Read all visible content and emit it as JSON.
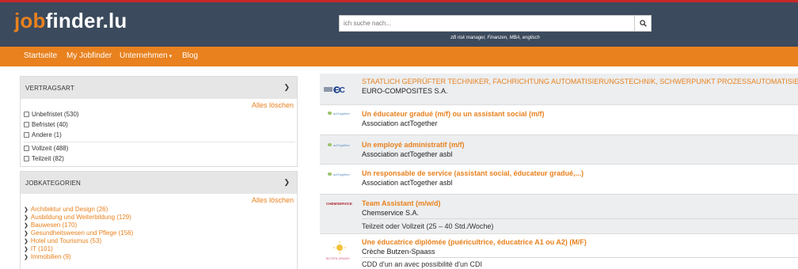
{
  "header": {
    "logo_part1": "job",
    "logo_part2": "finder.lu",
    "search_placeholder": "ich suche nach...",
    "search_hint": "zB risk manager, Finanzen, MBA, englisch"
  },
  "nav": {
    "items": [
      "Startseite",
      "My Jobfinder",
      "Unternehmen",
      "Blog"
    ]
  },
  "filters": {
    "vertragsart": {
      "title": "VERTRAGSART",
      "clear_label": "Alles löschen",
      "options": [
        "Unbefristet (530)",
        "Befristet (40)",
        "Andere (1)",
        "Vollzeit (488)",
        "Teilzeit (82)"
      ]
    },
    "jobkategorien": {
      "title": "JOBKATEGORIEN",
      "clear_label": "Alles löschen",
      "items": [
        "Architektur und Design (26)",
        "Ausbildung und Weiterbildung (129)",
        "Bauwesen (170)",
        "Gesundheitswesen und Pflege (156)",
        "Hotel und Tourismus (53)",
        "IT (101)",
        "Immobilien (9)"
      ]
    }
  },
  "jobs": [
    {
      "title": "STAATLICH GEPRÜFTER TECHNIKER, FACHRICHTUNG AUTOMATISIERUNGSTECHNIK, SCHWERPUNKT PROZESSAUTOMATISIERU",
      "company": "EURO-COMPOSITES S.A.",
      "logo_text": "EC"
    },
    {
      "title": "Un éducateur gradué (m/f) ou un assistant social (m/f)",
      "company": "Association actTogether",
      "logo_text": "actTogether"
    },
    {
      "title": "Un employé administratif (m/f)",
      "company": "Association actTogether asbl",
      "logo_text": "actTogether"
    },
    {
      "title": "Un responsable de service (assistant social, éducateur gradué,...)",
      "company": "Association actTogether asbl",
      "logo_text": "actTogether"
    },
    {
      "title": "Team Assistant (m/w/d)",
      "company": "Chemservice S.A.",
      "extra": "Teilzeit oder Vollzeit (25 – 40 Std./Woche)",
      "logo_text": "CHEMSERVICE"
    },
    {
      "title": "Une éducatrice diplômée (puéricultrice, éducatrice A1 ou A2) (M/F)",
      "company": "Crèche Butzen-Spaass",
      "extra": "CDD d'un an avec possibilité d'un CDI",
      "logo_text": "BUTZEN-SPAASS"
    }
  ],
  "colors": {
    "brand_orange": "#e8811e",
    "header_navy": "#3b4a5d",
    "top_red": "#c62828"
  }
}
